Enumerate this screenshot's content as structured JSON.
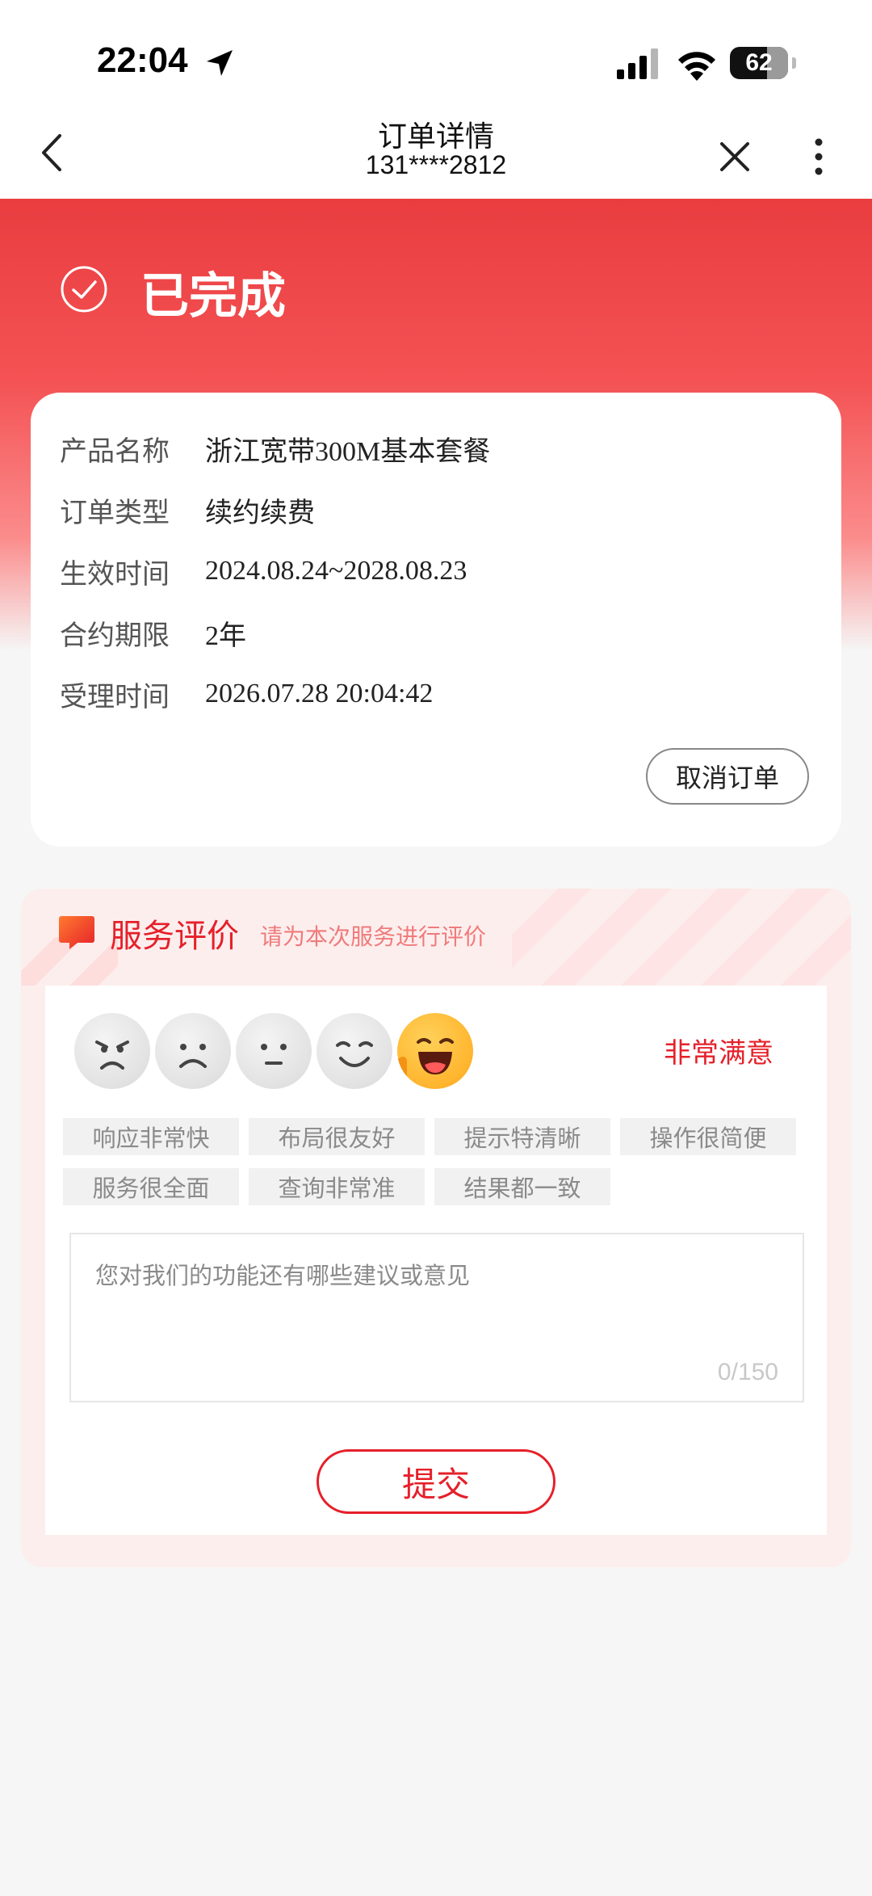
{
  "status_bar": {
    "time": "22:04",
    "battery": "62",
    "icons": [
      "location-arrow-icon",
      "signal-icon",
      "wifi-icon",
      "battery-icon"
    ]
  },
  "nav": {
    "title": "订单详情",
    "subtitle": "131****2812",
    "icons": [
      "back-icon",
      "close-icon",
      "more-icon"
    ]
  },
  "order": {
    "status": "已完成",
    "rows": [
      {
        "label": "产品名称",
        "value": "浙江宽带300M基本套餐"
      },
      {
        "label": "订单类型",
        "value": "续约续费"
      },
      {
        "label": "生效时间",
        "value": "2024.08.24~2028.08.23"
      },
      {
        "label": "合约期限",
        "value": "2年"
      },
      {
        "label": "受理时间",
        "value": "2026.07.28 20:04:42"
      }
    ],
    "cancel_label": "取消订单"
  },
  "review": {
    "title": "服务评价",
    "subtitle": "请为本次服务进行评价",
    "faces": [
      "angry-face-icon",
      "sad-face-icon",
      "neutral-face-icon",
      "smile-face-icon",
      "laughing-face-icon"
    ],
    "selected_rating_label": "非常满意",
    "tags": [
      "响应非常快",
      "布局很友好",
      "提示特清晰",
      "操作很简便",
      "服务很全面",
      "查询非常准",
      "结果都一致"
    ],
    "feedback_placeholder": "您对我们的功能还有哪些建议或意见",
    "counter": "0/150",
    "submit_label": "提交"
  },
  "colors": {
    "brand_red": "#e5202a",
    "header_red": "#e93d40",
    "background": "#f6f6f6"
  }
}
